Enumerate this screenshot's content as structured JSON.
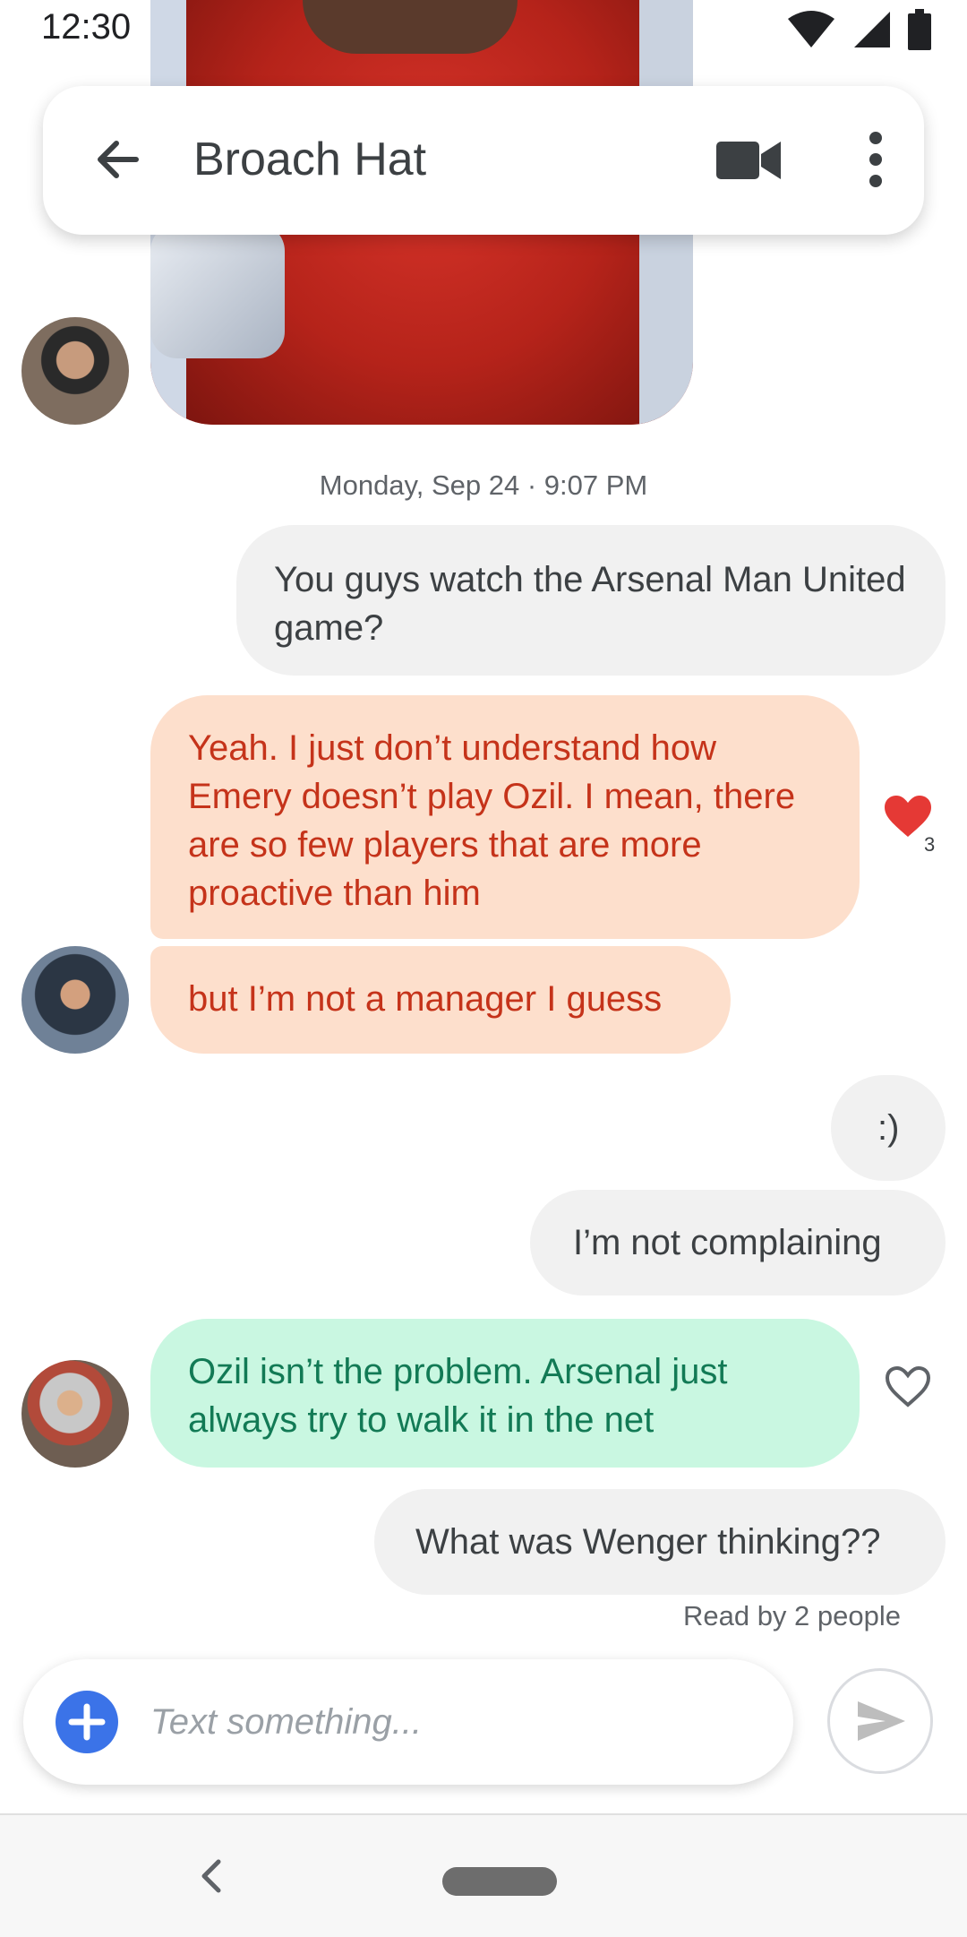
{
  "status_bar": {
    "time": "12:30"
  },
  "header": {
    "title": "Broach Hat"
  },
  "timestamp": "Monday, Sep 24 · 9:07 PM",
  "messages": {
    "m1": "You guys watch the Arsenal Man United game?",
    "m2": "Yeah. I just don’t understand how Emery doesn’t play Ozil. I mean, there are so few players that are more proactive than him",
    "m3": "but I’m not a manager I guess",
    "m4": ":)",
    "m5": "I’m not complaining",
    "m6": "Ozil isn’t the problem. Arsenal just always try to walk it in the net",
    "m7": "What was Wenger thinking??"
  },
  "reactions": {
    "m2_heart_count": "3"
  },
  "read_receipt": "Read by 2 people",
  "composer": {
    "placeholder": "Text something..."
  },
  "colors": {
    "accent": "#3b73e8",
    "outgoing_bubble": "#f1f1f1",
    "incoming_orange_bubble": "#fddfcc",
    "incoming_orange_text": "#c5331a",
    "incoming_green_bubble": "#c9f7e1",
    "incoming_green_text": "#127a55",
    "heart": "#e53935"
  },
  "icons": [
    "back-arrow-icon",
    "video-call-icon",
    "more-vert-icon",
    "heart-filled-icon",
    "heart-outline-icon",
    "add-icon",
    "send-icon",
    "wifi-icon",
    "signal-icon",
    "battery-icon",
    "nav-back-icon",
    "nav-home-pill"
  ]
}
